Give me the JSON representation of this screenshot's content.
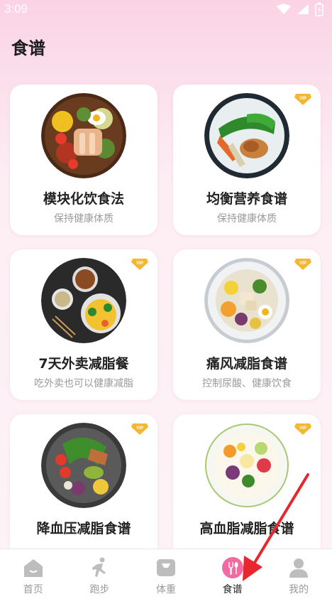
{
  "status_bar": {
    "time": "3:09"
  },
  "header": {
    "title": "食谱"
  },
  "recipes": [
    {
      "title": "模块化饮食法",
      "subtitle": "保持健康体质",
      "vip": false
    },
    {
      "title": "均衡营养食谱",
      "subtitle": "保持健康体质",
      "vip": true
    },
    {
      "title": "7天外卖减脂餐",
      "subtitle": "吃外卖也可以健康减脂",
      "vip": true
    },
    {
      "title": "痛风减脂食谱",
      "subtitle": "控制尿酸、健康饮食",
      "vip": true
    },
    {
      "title": "降血压减脂食谱",
      "subtitle": "",
      "vip": true
    },
    {
      "title": "高血脂减脂食谱",
      "subtitle": "",
      "vip": true
    }
  ],
  "vip_label": "VIP",
  "nav": {
    "items": [
      {
        "label": "首页",
        "icon": "home-icon"
      },
      {
        "label": "跑步",
        "icon": "running-icon"
      },
      {
        "label": "体重",
        "icon": "scale-icon"
      },
      {
        "label": "食谱",
        "icon": "fork-spoon-icon",
        "active": true
      },
      {
        "label": "我的",
        "icon": "profile-icon"
      }
    ]
  },
  "colors": {
    "accent": "#f46aa0",
    "vip_gold": "#f5b731",
    "background": "#fdf0f5"
  }
}
